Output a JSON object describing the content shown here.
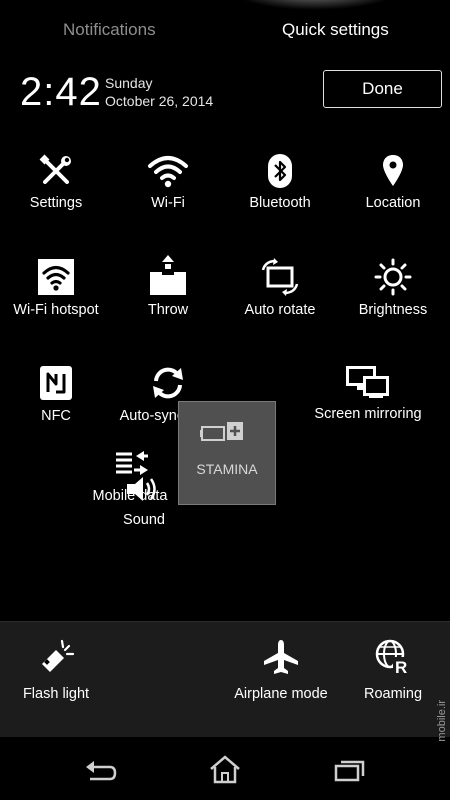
{
  "tabs": {
    "notifications": "Notifications",
    "quick_settings": "Quick settings"
  },
  "clock": {
    "time": "2:42",
    "day": "Sunday",
    "date": "October 26, 2014"
  },
  "done_label": "Done",
  "tiles": {
    "settings": "Settings",
    "wifi": "Wi-Fi",
    "bluetooth": "Bluetooth",
    "location": "Location",
    "wifi_hotspot": "Wi-Fi hotspot",
    "throw": "Throw",
    "auto_rotate": "Auto rotate",
    "brightness": "Brightness",
    "nfc": "NFC",
    "auto_sync": "Auto-sync data",
    "screen_mirroring": "Screen mirroring",
    "mobile_data": "Mobile data",
    "sound": "Sound",
    "stamina": "STAMINA"
  },
  "bottom_tiles": {
    "flash_light": "Flash light",
    "airplane_mode": "Airplane mode",
    "roaming": "Roaming"
  },
  "watermark": "mobile.ir",
  "icons": [
    "wrench-screwdriver-icon",
    "wifi-icon",
    "bluetooth-icon",
    "location-pin-icon",
    "wifi-hotspot-icon",
    "throw-icon",
    "auto-rotate-icon",
    "brightness-icon",
    "nfc-icon",
    "sync-icon",
    "screen-mirroring-icon",
    "mobile-data-icon",
    "speaker-icon",
    "battery-plus-icon",
    "flashlight-icon",
    "airplane-icon",
    "roaming-globe-icon",
    "back-icon",
    "home-icon",
    "recents-icon"
  ]
}
